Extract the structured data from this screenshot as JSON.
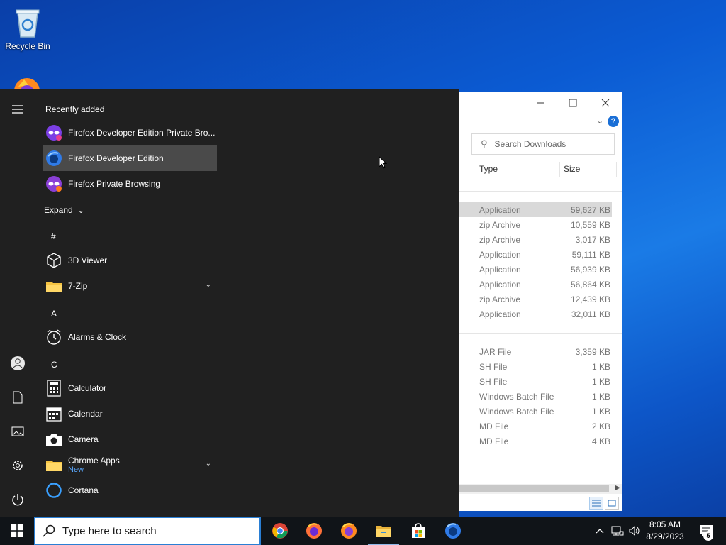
{
  "desktop": {
    "recycle_bin_label": "Recycle Bin"
  },
  "explorer": {
    "search_placeholder": "Search Downloads",
    "columns": {
      "type": "Type",
      "size": "Size"
    },
    "group1": [
      {
        "type": "Application",
        "size": "59,627 KB",
        "selected": true
      },
      {
        "type": "zip Archive",
        "size": "10,559 KB"
      },
      {
        "type": "zip Archive",
        "size": "3,017 KB"
      },
      {
        "type": "Application",
        "size": "59,111 KB"
      },
      {
        "type": "Application",
        "size": "56,939 KB"
      },
      {
        "type": "Application",
        "size": "56,864 KB"
      },
      {
        "type": "zip Archive",
        "size": "12,439 KB"
      },
      {
        "type": "Application",
        "size": "32,011 KB"
      }
    ],
    "group2": [
      {
        "type": "JAR File",
        "size": "3,359 KB"
      },
      {
        "type": "SH File",
        "size": "1 KB"
      },
      {
        "type": "SH File",
        "size": "1 KB"
      },
      {
        "type": "Windows Batch File",
        "size": "1 KB"
      },
      {
        "type": "Windows Batch File",
        "size": "1 KB"
      },
      {
        "type": "MD File",
        "size": "2 KB"
      },
      {
        "type": "MD File",
        "size": "4 KB"
      }
    ]
  },
  "start_menu": {
    "recently_added_title": "Recently added",
    "recent": [
      {
        "label": "Firefox Developer Edition Private Bro...",
        "icon": "firefox-dev-private-icon"
      },
      {
        "label": "Firefox Developer Edition",
        "icon": "firefox-dev-icon"
      },
      {
        "label": "Firefox Private Browsing",
        "icon": "firefox-private-icon"
      }
    ],
    "expand_label": "Expand",
    "letters": {
      "hash": "#",
      "a": "A",
      "c": "C"
    },
    "apps": {
      "viewer3d": "3D Viewer",
      "zip7": "7-Zip",
      "alarms": "Alarms & Clock",
      "calculator": "Calculator",
      "calendar": "Calendar",
      "camera": "Camera",
      "chrome_apps": "Chrome Apps",
      "chrome_apps_sub": "New",
      "cortana": "Cortana"
    }
  },
  "taskbar": {
    "search_placeholder": "Type here to search",
    "time": "8:05 AM",
    "date": "8/29/2023",
    "notification_count": "5"
  },
  "colors": {
    "accent": "#2a7fd4",
    "start_bg": "#202020",
    "taskbar_bg": "#101418"
  }
}
